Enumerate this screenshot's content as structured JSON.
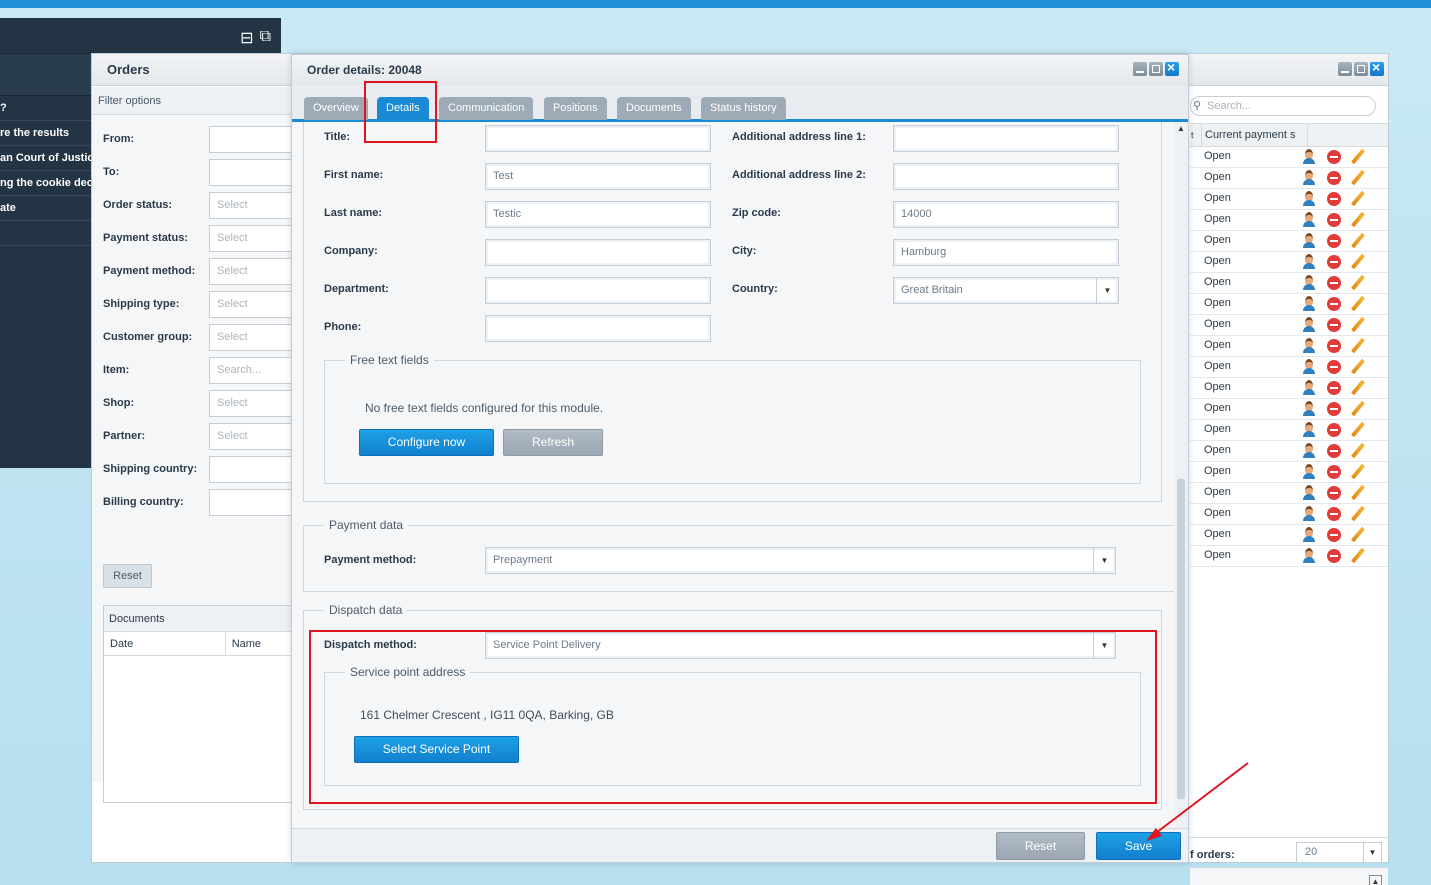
{
  "left_menu": {
    "items": [
      "?",
      "re the results",
      "an Court of Justic",
      "ng the cookie dec",
      "ate"
    ]
  },
  "orders_window": {
    "title": "Orders",
    "filter_header": "Filter options",
    "filters": [
      {
        "label": "From:",
        "placeholder": ""
      },
      {
        "label": "To:",
        "placeholder": ""
      },
      {
        "label": "Order status:",
        "placeholder": "Select"
      },
      {
        "label": "Payment status:",
        "placeholder": "Select"
      },
      {
        "label": "Payment method:",
        "placeholder": "Select"
      },
      {
        "label": "Shipping type:",
        "placeholder": "Select"
      },
      {
        "label": "Customer group:",
        "placeholder": "Select"
      },
      {
        "label": "Item:",
        "placeholder": "Search..."
      },
      {
        "label": "Shop:",
        "placeholder": "Select"
      },
      {
        "label": "Partner:",
        "placeholder": "Select"
      },
      {
        "label": "Shipping country:",
        "placeholder": ""
      },
      {
        "label": "Billing country:",
        "placeholder": ""
      }
    ],
    "reset_label": "Reset",
    "documents": {
      "title": "Documents",
      "columns": [
        "Date",
        "Name"
      ]
    },
    "list": {
      "search_placeholder": "Search...",
      "columns": [
        "t",
        "Current payment s"
      ],
      "status_values": [
        "Open",
        "Open",
        "Open",
        "Open",
        "Open",
        "Open",
        "Open",
        "Open",
        "Open",
        "Open",
        "Open",
        "Open",
        "Open",
        "Open",
        "Open",
        "Open",
        "Open",
        "Open",
        "Open",
        "Open"
      ],
      "footer_label": "f orders:",
      "page_size": "20"
    }
  },
  "order_details": {
    "title": "Order details: 20048",
    "tabs": [
      "Overview",
      "Details",
      "Communication",
      "Positions",
      "Documents",
      "Status history"
    ],
    "active_tab": "Details",
    "left_fields": [
      {
        "label": "Title:",
        "value": ""
      },
      {
        "label": "First name:",
        "value": "Test"
      },
      {
        "label": "Last name:",
        "value": "Testic"
      },
      {
        "label": "Company:",
        "value": ""
      },
      {
        "label": "Department:",
        "value": ""
      },
      {
        "label": "Phone:",
        "value": ""
      }
    ],
    "right_fields": [
      {
        "label": "Additional address line 1:",
        "value": ""
      },
      {
        "label": "Additional address line 2:",
        "value": ""
      },
      {
        "label": "Zip code:",
        "value": "14000"
      },
      {
        "label": "City:",
        "value": "Hamburg"
      },
      {
        "label": "Country:",
        "value": "Great Britain"
      }
    ],
    "free_text": {
      "legend": "Free text fields",
      "message": "No free text fields configured for this module.",
      "configure_label": "Configure now",
      "refresh_label": "Refresh"
    },
    "payment": {
      "legend": "Payment data",
      "method_label": "Payment method:",
      "method_value": "Prepayment"
    },
    "dispatch": {
      "legend": "Dispatch data",
      "method_label": "Dispatch method:",
      "method_value": "Service Point Delivery",
      "service_point_legend": "Service point address",
      "service_point_address": "161 Chelmer Crescent , IG11 0QA, Barking, GB",
      "select_label": "Select Service Point"
    },
    "footer": {
      "reset_label": "Reset",
      "save_label": "Save"
    }
  },
  "colors": {
    "accent": "#1a8ad4",
    "highlight": "#e0141e",
    "dark_menu": "#233444"
  }
}
